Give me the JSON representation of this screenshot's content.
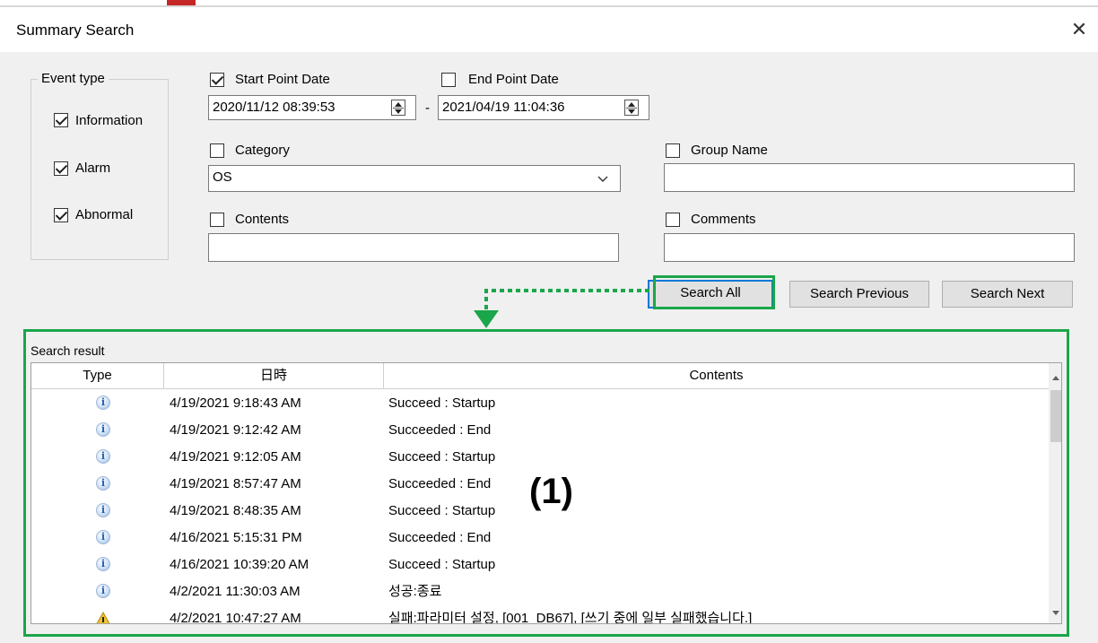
{
  "window": {
    "title": "Summary Search",
    "close_symbol": "✕"
  },
  "event_type": {
    "legend": "Event type",
    "items": [
      {
        "label": "Information",
        "checked": true
      },
      {
        "label": "Alarm",
        "checked": true
      },
      {
        "label": "Abnormal",
        "checked": true
      }
    ]
  },
  "filters": {
    "start_date": {
      "label": "Start Point Date",
      "checked": true,
      "value": "2020/11/12 08:39:53"
    },
    "separator": "-",
    "end_date": {
      "label": "End Point Date",
      "checked": false,
      "value": "2021/04/19 11:04:36"
    },
    "category": {
      "label": "Category",
      "checked": false,
      "value": "OS"
    },
    "group_name": {
      "label": "Group Name",
      "checked": false,
      "value": ""
    },
    "contents": {
      "label": "Contents",
      "checked": false,
      "value": ""
    },
    "comments": {
      "label": "Comments",
      "checked": false,
      "value": ""
    }
  },
  "buttons": {
    "search_all": "Search All",
    "search_previous": "Search Previous",
    "search_next": "Search Next"
  },
  "results": {
    "label": "Search result",
    "columns": [
      "Type",
      "日時",
      "Contents"
    ],
    "rows": [
      {
        "type": "info",
        "datetime": "4/19/2021 9:18:43 AM",
        "contents": "Succeed : Startup"
      },
      {
        "type": "info",
        "datetime": "4/19/2021 9:12:42 AM",
        "contents": "Succeeded : End"
      },
      {
        "type": "info",
        "datetime": "4/19/2021 9:12:05 AM",
        "contents": "Succeed : Startup"
      },
      {
        "type": "info",
        "datetime": "4/19/2021 8:57:47 AM",
        "contents": "Succeeded : End"
      },
      {
        "type": "info",
        "datetime": "4/19/2021 8:48:35 AM",
        "contents": "Succeed : Startup"
      },
      {
        "type": "info",
        "datetime": "4/16/2021 5:15:31 PM",
        "contents": "Succeeded : End"
      },
      {
        "type": "info",
        "datetime": "4/16/2021 10:39:20 AM",
        "contents": "Succeed : Startup"
      },
      {
        "type": "info",
        "datetime": "4/2/2021 11:30:03 AM",
        "contents": "성공:종료"
      },
      {
        "type": "warning",
        "datetime": "4/2/2021 10:47:27 AM",
        "contents": "실패:파라미터 설정, [001_DB67], [쓰기 중에 일부 실패했습니다.]"
      }
    ]
  },
  "annotation": {
    "label": "(1)",
    "color": "#1aa64a"
  }
}
